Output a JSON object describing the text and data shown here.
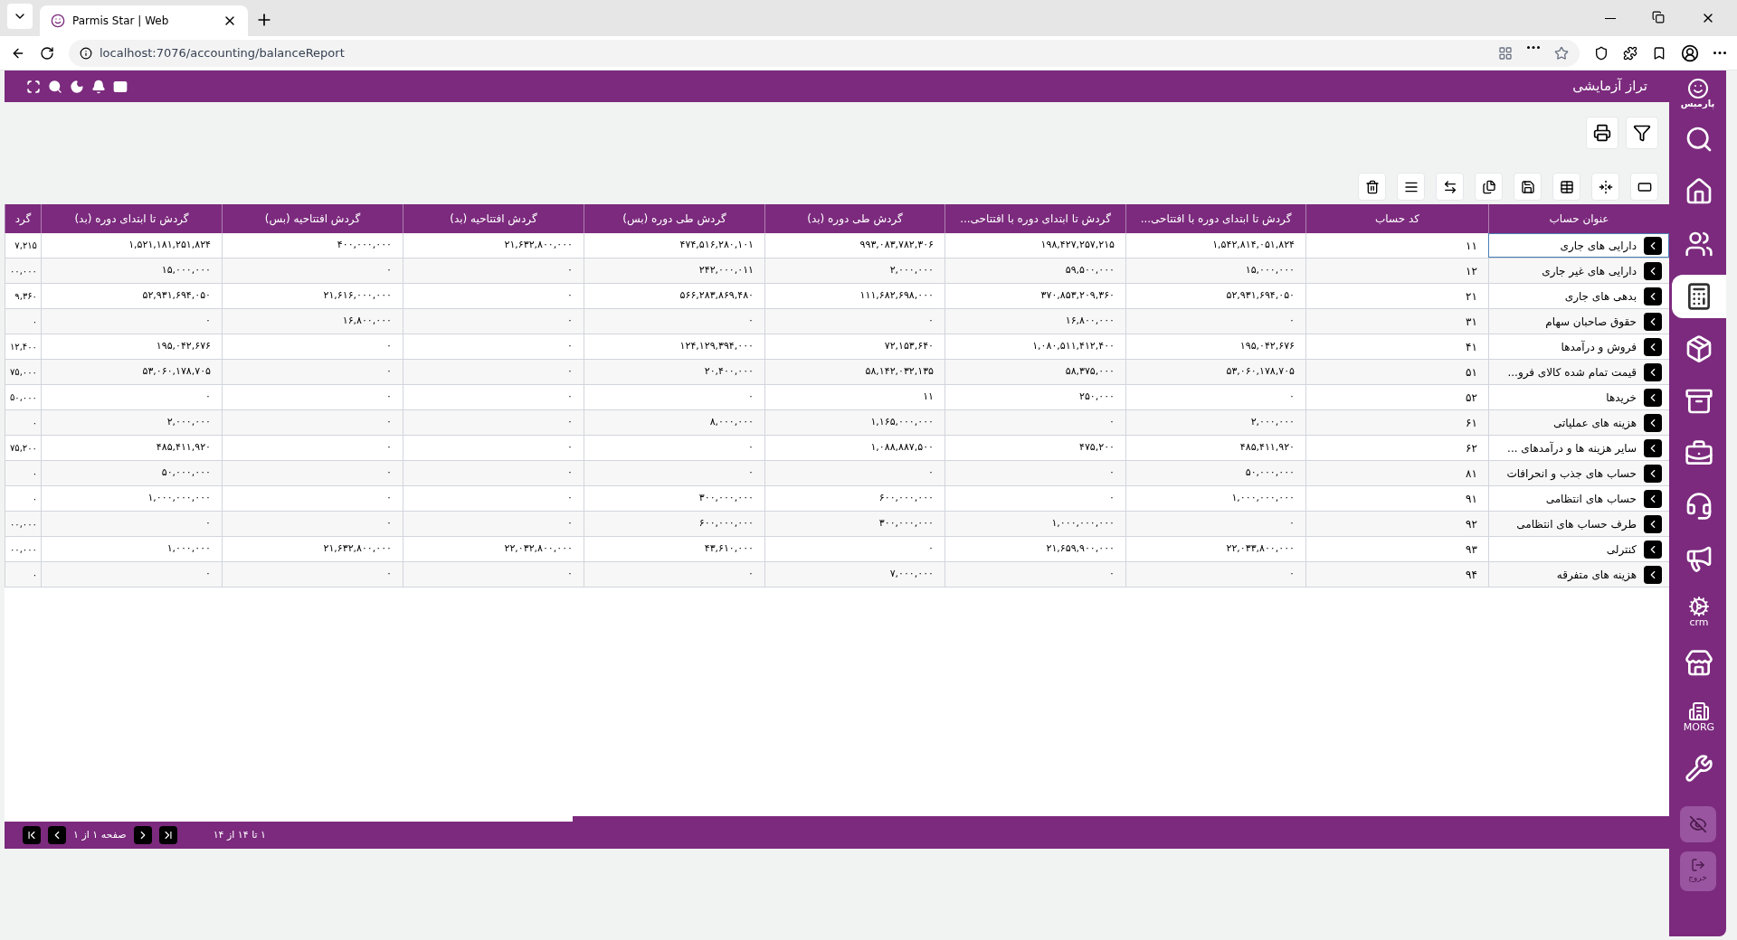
{
  "browser": {
    "tab_title": "Parmis Star | Web",
    "url": "localhost:7076/accounting/balanceReport"
  },
  "header": {
    "title": "تراز آزمایشی"
  },
  "sidebar": {
    "logo_text": "پارمیس",
    "items": [
      {
        "selected": false
      },
      {
        "selected": false
      },
      {
        "selected": false
      },
      {
        "selected": true
      },
      {
        "selected": false
      },
      {
        "selected": false
      },
      {
        "selected": false
      },
      {
        "selected": false
      },
      {
        "selected": false
      },
      {
        "selected": false,
        "label": "crm"
      },
      {
        "selected": false
      },
      {
        "selected": false,
        "label": "MORG"
      },
      {
        "selected": false
      }
    ],
    "exit_button": {
      "label": "خروج"
    }
  },
  "table": {
    "columns": [
      "عنوان حساب",
      "کد حساب",
      "گردش تا ابتدای دوره با افتتاحی...",
      "گردش تا ابتدای دوره با افتتاحی...",
      "گردش طی دوره (بد)",
      "گردش طی دوره (بس)",
      "گردش افتتاحیه (بد)",
      "گردش افتتاحیه (بس)",
      "گردش تا ابتدای دوره (بد)",
      "گرد"
    ],
    "rows": [
      {
        "selected": true,
        "title": "دارایی های جاری",
        "code": "۱۱",
        "values": [
          "۱,۵۴۲,۸۱۴,۰۵۱,۸۲۴",
          "۱۹۸,۴۲۷,۲۵۷,۲۱۵",
          "۹۹۳,۰۸۳,۷۸۲,۳۰۶",
          "۴۷۴,۵۱۶,۲۸۰,۱۰۱",
          "۲۱,۶۳۲,۸۰۰,۰۰۰",
          "۴۰۰,۰۰۰,۰۰۰",
          "۱,۵۲۱,۱۸۱,۲۵۱,۸۲۴",
          "۷,۲۱۵"
        ]
      },
      {
        "selected": false,
        "title": "دارایی های غیر جاری",
        "code": "۱۲",
        "values": [
          "۱۵,۰۰۰,۰۰۰",
          "۵۹,۵۰۰,۰۰۰",
          "۲,۰۰۰,۰۰۰",
          "۲۴۲,۰۰۰,۰۱۱",
          "۰",
          "۰",
          "۱۵,۰۰۰,۰۰۰",
          "۰۰,۰۰۰"
        ]
      },
      {
        "selected": false,
        "title": "بدهی های جاری",
        "code": "۲۱",
        "values": [
          "۵۲,۹۳۱,۶۹۴,۰۵۰",
          "۳۷۰,۸۵۳,۲۰۹,۳۶۰",
          "۱۱۱,۶۸۲,۶۹۸,۰۰۰",
          "۵۶۶,۲۸۳,۸۶۹,۴۸۰",
          "۰",
          "۲۱,۶۱۶,۰۰۰,۰۰۰",
          "۵۲,۹۳۱,۶۹۴,۰۵۰",
          "۹,۳۶۰"
        ]
      },
      {
        "selected": false,
        "title": "حقوق صاحبان سهام",
        "code": "۳۱",
        "values": [
          "۰",
          "۱۶,۸۰۰,۰۰۰",
          "۰",
          "۰",
          "۰",
          "۱۶,۸۰۰,۰۰۰",
          "۰",
          "۰"
        ]
      },
      {
        "selected": false,
        "title": "فروش و درآمدها",
        "code": "۴۱",
        "values": [
          "۱۹۵,۰۴۲,۶۷۶",
          "۱,۰۸۰,۵۱۱,۴۱۲,۴۰۰",
          "۷۲,۱۵۳,۶۴۰",
          "۱۲۴,۱۲۹,۳۹۴,۰۰۰",
          "۰",
          "۰",
          "۱۹۵,۰۴۲,۶۷۶",
          "۱۲,۴۰۰"
        ]
      },
      {
        "selected": false,
        "title": "قیمت تمام شده کالای فرو...",
        "code": "۵۱",
        "values": [
          "۵۳,۰۶۰,۱۷۸,۷۰۵",
          "۵۸,۳۷۵,۰۰۰",
          "۵۸,۱۴۲,۰۳۲,۱۳۵",
          "۲۰,۴۰۰,۰۰۰",
          "۰",
          "۰",
          "۵۳,۰۶۰,۱۷۸,۷۰۵",
          "۷۵,۰۰۰"
        ]
      },
      {
        "selected": false,
        "title": "خریدها",
        "code": "۵۲",
        "values": [
          "۰",
          "۲۵۰,۰۰۰",
          "۱۱",
          "۰",
          "۰",
          "۰",
          "۰",
          "۵۰,۰۰۰"
        ]
      },
      {
        "selected": false,
        "title": "هزینه های عملیاتی",
        "code": "۶۱",
        "values": [
          "۲,۰۰۰,۰۰۰",
          "۰",
          "۱,۱۶۵,۰۰۰,۰۰۰",
          "۸,۰۰۰,۰۰۰",
          "۰",
          "۰",
          "۲,۰۰۰,۰۰۰",
          "۰"
        ]
      },
      {
        "selected": false,
        "title": "سایر هزینه ها و درآمدهای ...",
        "code": "۶۲",
        "values": [
          "۴۸۵,۴۱۱,۹۲۰",
          "۴۷۵,۲۰۰",
          "۱,۰۸۸,۸۸۷,۵۰۰",
          "۰",
          "۰",
          "۰",
          "۴۸۵,۴۱۱,۹۲۰",
          "۷۵,۲۰۰"
        ]
      },
      {
        "selected": false,
        "title": "حساب های جذب و انحرافات",
        "code": "۸۱",
        "values": [
          "۵۰,۰۰۰,۰۰۰",
          "۰",
          "۰",
          "۰",
          "۰",
          "۰",
          "۵۰,۰۰۰,۰۰۰",
          "۰"
        ]
      },
      {
        "selected": false,
        "title": "حساب های انتظامی",
        "code": "۹۱",
        "values": [
          "۱,۰۰۰,۰۰۰,۰۰۰",
          "۰",
          "۶۰۰,۰۰۰,۰۰۰",
          "۳۰۰,۰۰۰,۰۰۰",
          "۰",
          "۰",
          "۱,۰۰۰,۰۰۰,۰۰۰",
          "۰"
        ]
      },
      {
        "selected": false,
        "title": "طرف حساب های انتظامی",
        "code": "۹۲",
        "values": [
          "۰",
          "۱,۰۰۰,۰۰۰,۰۰۰",
          "۳۰۰,۰۰۰,۰۰۰",
          "۶۰۰,۰۰۰,۰۰۰",
          "۰",
          "۰",
          "۰",
          "۰۰,۰۰۰"
        ]
      },
      {
        "selected": false,
        "title": "کنترلی",
        "code": "۹۳",
        "values": [
          "۲۲,۰۳۳,۸۰۰,۰۰۰",
          "۲۱,۶۵۹,۹۰۰,۰۰۰",
          "۰",
          "۴۳,۶۱۰,۰۰۰",
          "۲۲,۰۳۲,۸۰۰,۰۰۰",
          "۲۱,۶۳۲,۸۰۰,۰۰۰",
          "۱,۰۰۰,۰۰۰",
          "۰۰,۰۰۰"
        ]
      },
      {
        "selected": false,
        "title": "هزینه های متفرقه",
        "code": "۹۴",
        "values": [
          "۰",
          "۰",
          "۷,۰۰۰,۰۰۰",
          "۰",
          "۰",
          "۰",
          "۰",
          "۰"
        ]
      }
    ]
  },
  "pager": {
    "page_label": "صفحه ۱ از ۱",
    "range_label": "۱ تا ۱۴ از ۱۴"
  }
}
